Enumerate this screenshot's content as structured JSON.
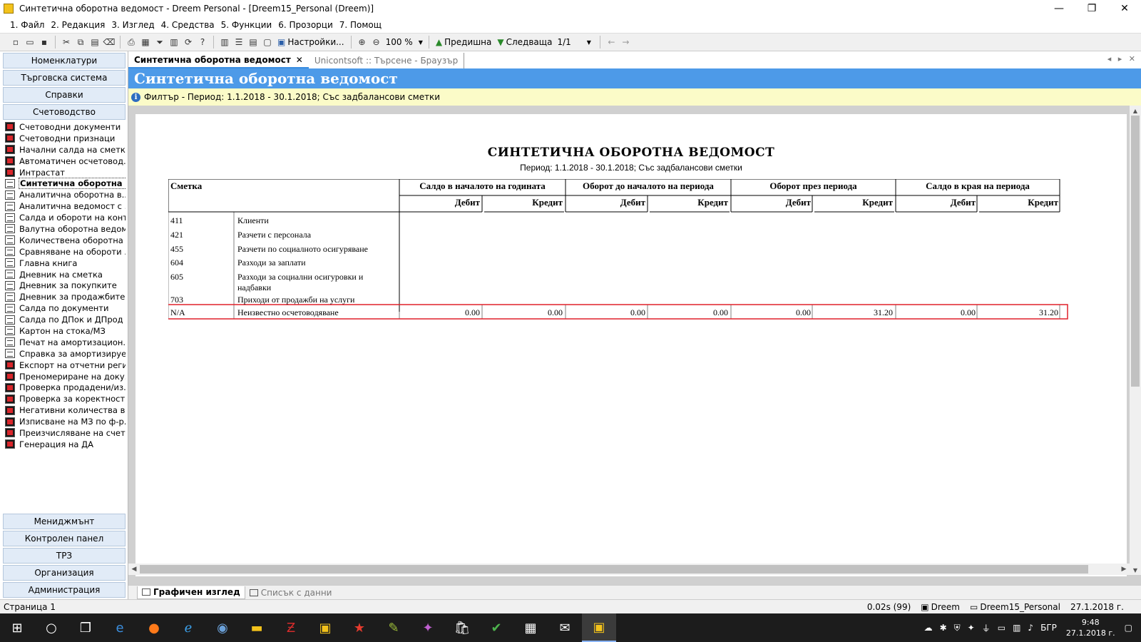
{
  "window": {
    "title": "Синтетична оборотна ведомост - Dreem Personal - [Dreem15_Personal (Dreem)]",
    "controls": [
      "—",
      "❐",
      "✕"
    ]
  },
  "menu": [
    "1. Файл",
    "2. Редакция",
    "3. Изглед",
    "4. Средства",
    "5. Функции",
    "6. Прозорци",
    "7. Помощ"
  ],
  "toolbar": {
    "settings_label": "Настройки...",
    "zoom_value": "100 %",
    "prev_label": "Предишна",
    "next_label": "Следваща",
    "page_value": "1/1"
  },
  "sidebar": {
    "top_groups": [
      "Номенклатури",
      "Търговска система",
      "Справки",
      "Счетоводство"
    ],
    "items": [
      {
        "label": "Счетоводни документи",
        "icon": "report-red-icon"
      },
      {
        "label": "Счетоводни признаци",
        "icon": "report-red-icon"
      },
      {
        "label": "Начални салда на сметки",
        "icon": "report-red-icon"
      },
      {
        "label": "Автоматичен осчетовод...",
        "icon": "report-red-icon"
      },
      {
        "label": "Интрастат",
        "icon": "report-red-icon"
      },
      {
        "label": "Синтетична оборотна в...",
        "icon": "document-icon",
        "selected": true
      },
      {
        "label": "Аналитична оборотна в...",
        "icon": "document-icon"
      },
      {
        "label": "Аналитична ведомост с ...",
        "icon": "document-icon"
      },
      {
        "label": "Салда и обороти на конт...",
        "icon": "document-icon"
      },
      {
        "label": "Валутна оборотна ведом...",
        "icon": "document-icon"
      },
      {
        "label": "Количествена оборотна ...",
        "icon": "document-icon"
      },
      {
        "label": "Сравняване на обороти ...",
        "icon": "document-icon"
      },
      {
        "label": "Главна книга",
        "icon": "document-icon"
      },
      {
        "label": "Дневник на сметка",
        "icon": "document-icon"
      },
      {
        "label": "Дневник за покупките",
        "icon": "document-icon"
      },
      {
        "label": "Дневник за продажбите",
        "icon": "document-icon"
      },
      {
        "label": "Салда по документи",
        "icon": "document-icon"
      },
      {
        "label": "Салда по ДПок и ДПрод",
        "icon": "document-icon"
      },
      {
        "label": "Картон на стока/МЗ",
        "icon": "document-icon"
      },
      {
        "label": "Печат на амортизацион...",
        "icon": "document-icon"
      },
      {
        "label": "Справка за амортизируе...",
        "icon": "document-icon"
      },
      {
        "label": "Експорт на отчетни реги...",
        "icon": "report-red-icon"
      },
      {
        "label": "Преномериране на доку...",
        "icon": "report-red-icon"
      },
      {
        "label": "Проверка продадени/из...",
        "icon": "report-red-icon"
      },
      {
        "label": "Проверка за коректност ...",
        "icon": "report-red-icon"
      },
      {
        "label": "Негативни количества в ...",
        "icon": "report-red-icon"
      },
      {
        "label": "Изписване на МЗ по ф-р...",
        "icon": "report-red-icon"
      },
      {
        "label": "Преизчисляване на счет...",
        "icon": "report-red-icon"
      },
      {
        "label": "Генерация на ДА",
        "icon": "report-red-icon"
      }
    ],
    "bottom_groups": [
      "Мениджмънт",
      "Контролен панел",
      "ТРЗ",
      "Организация",
      "Администрация"
    ]
  },
  "tabs": {
    "active": "Синтетична оборотна ведомост",
    "inactive": "Unicontsoft :: Търсене - Браузър"
  },
  "report_header": "Синтетична оборотна ведомост",
  "filter": "Филтър - Период: 1.1.2018 - 30.1.2018; Със задбалансови сметки",
  "report": {
    "title": "СИНТЕТИЧНА ОБОРОТНА ВЕДОМОСТ",
    "period": "Период: 1.1.2018 - 30.1.2018; Със задбалансови сметки",
    "account_header": "Сметка",
    "group_headers": [
      "Салдо в началото на годината",
      "Оборот до началото на периода",
      "Оборот през периода",
      "Салдо в края на периода"
    ],
    "debit_label": "Дебит",
    "credit_label": "Кредит",
    "rows": [
      {
        "code": "411",
        "name": "Клиенти"
      },
      {
        "code": "421",
        "name": "Разчети с персонала"
      },
      {
        "code": "455",
        "name": "Разчети по социалното осигуряване"
      },
      {
        "code": "604",
        "name": "Разходи за заплати"
      },
      {
        "code": "605",
        "name": "Разходи за социални осигуровки и",
        "name2": "надбавки"
      },
      {
        "code": "703",
        "name": "Приходи от продажби на услуги"
      }
    ],
    "highlighted_row": {
      "code": "N/A",
      "name": "Неизвестно осчетоводяване",
      "values": [
        "0.00",
        "0.00",
        "0.00",
        "0.00",
        "0.00",
        "31.20",
        "0.00",
        "31.20"
      ]
    }
  },
  "view_tabs": {
    "active": "Графичен изглед",
    "inactive": "Списък с данни"
  },
  "status": {
    "page": "Страница 1",
    "timing": "0.02s (99)",
    "user": "Dreem",
    "database": "Dreem15_Personal",
    "date": "27.1.2018 г."
  },
  "taskbar": {
    "language": "БГР",
    "time": "9:48",
    "date": "27.1.2018 г."
  },
  "colors": {
    "header_blue": "#4d9ae8",
    "filter_yellow": "#fbfbc8",
    "highlight_red": "#e0202a"
  }
}
